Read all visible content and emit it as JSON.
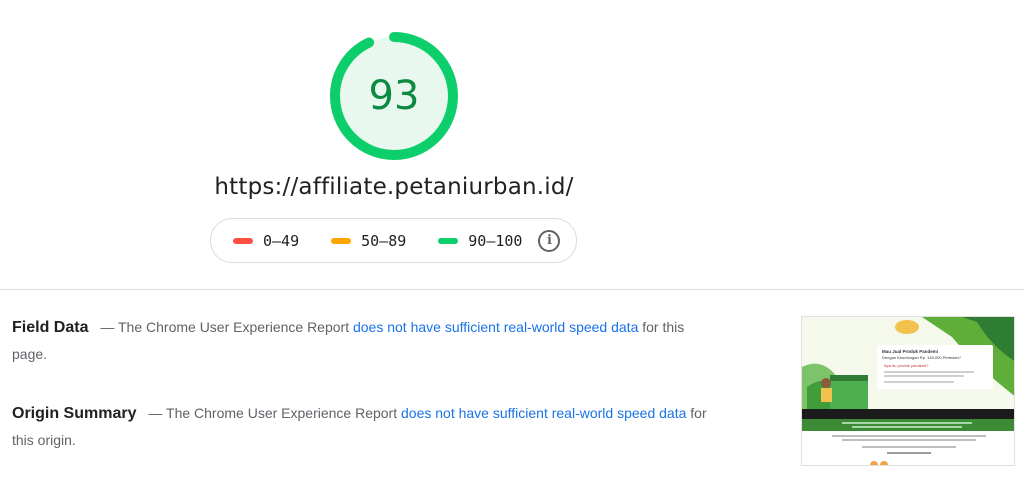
{
  "score": {
    "value": 93,
    "fraction": 0.93,
    "ring_color": "#0cce6b",
    "fill_color": "#e8f8ee",
    "text_color": "#0c8a3f"
  },
  "url": "https://affiliate.petaniurban.id/",
  "legend": [
    {
      "label": "0–49",
      "color": "#ff4e42"
    },
    {
      "label": "50–89",
      "color": "#ffa400"
    },
    {
      "label": "90–100",
      "color": "#0cce6b"
    }
  ],
  "legend_info_icon": "i",
  "field_data": {
    "heading": "Field Data",
    "text_before": "— The Chrome User Experience Report ",
    "link": "does not have sufficient real-world speed data",
    "text_after": " for this page."
  },
  "origin_summary": {
    "heading": "Origin Summary",
    "text_before": "— The Chrome User Experience Report ",
    "link": "does not have sufficient real-world speed data",
    "text_after": " for this origin."
  },
  "thumbnail": {
    "title_line1": "Mau Jual Produk Pandemi",
    "title_line2": "Dengan Keuntungan Rp. 145.000 Perbulan?",
    "subtitle": "Apa itu produk pandemi?"
  }
}
